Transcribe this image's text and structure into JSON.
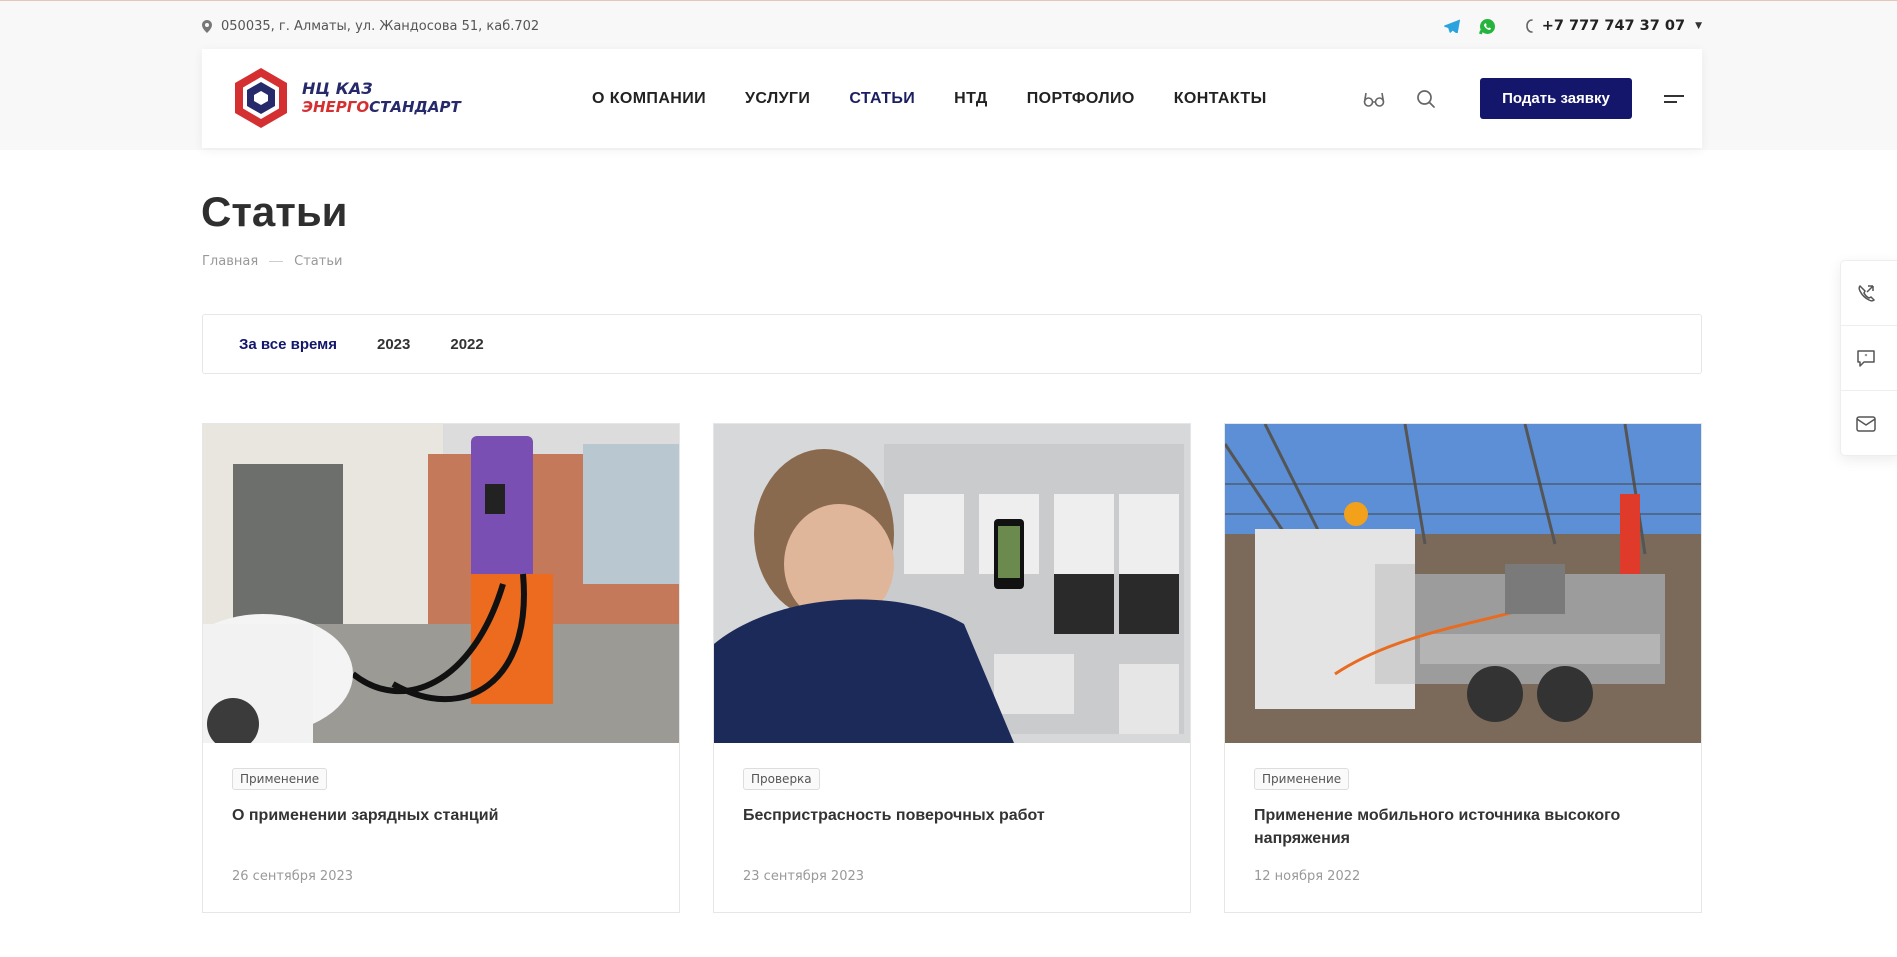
{
  "topbar": {
    "address": "050035, г. Алматы, ул. Жандосова 51, каб.702",
    "phone": "+7 777 747 37 07",
    "icons": [
      "location-pin-icon",
      "telegram-icon",
      "whatsapp-icon",
      "phone-icon"
    ]
  },
  "logo": {
    "line1": "НЦ КАЗ",
    "line2_red": "ЭНЕРГО",
    "line2_navy": "СТАНДАРТ"
  },
  "nav": [
    {
      "label": "О КОМПАНИИ"
    },
    {
      "label": "УСЛУГИ"
    },
    {
      "label": "СТАТЬИ",
      "active": true
    },
    {
      "label": "НТД"
    },
    {
      "label": "ПОРТФОЛИО"
    },
    {
      "label": "КОНТАКТЫ"
    }
  ],
  "header": {
    "apply_label": "Подать заявку"
  },
  "page": {
    "title": "Статьи"
  },
  "breadcrumb": {
    "home": "Главная",
    "current": "Статьи"
  },
  "filters": [
    {
      "label": "За все время",
      "active": true
    },
    {
      "label": "2023"
    },
    {
      "label": "2022"
    }
  ],
  "cards": [
    {
      "tag": "Применение",
      "title": "О применении зарядных станций",
      "date": "26 сентября 2023"
    },
    {
      "tag": "Проверка",
      "title": "Беспристрасность поверочных работ",
      "date": "23 сентября 2023"
    },
    {
      "tag": "Применение",
      "title": "Применение мобильного источника высокого напряжения",
      "date": "12 ноября 2022"
    }
  ],
  "colors": {
    "brand_navy": "#13166a",
    "logo_red": "#d53031",
    "telegram": "#2aa3df",
    "whatsapp": "#27b43e"
  }
}
